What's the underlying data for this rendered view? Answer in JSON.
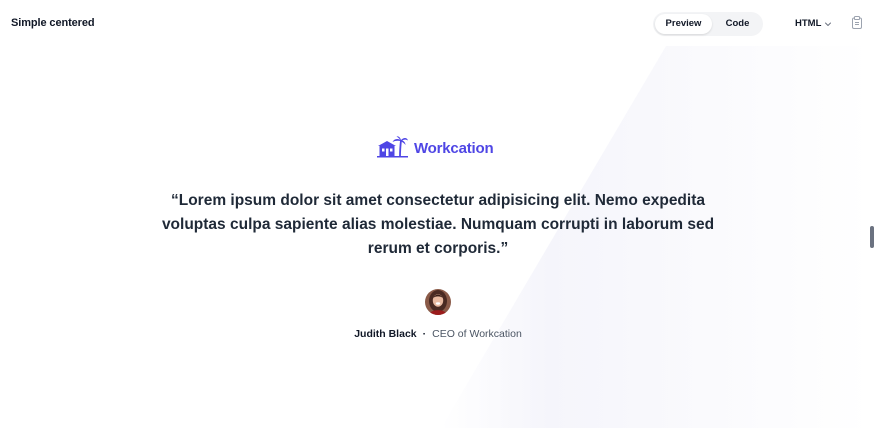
{
  "header": {
    "title": "Simple centered",
    "tabs": [
      {
        "label": "Preview",
        "selected": true
      },
      {
        "label": "Code",
        "selected": false
      }
    ],
    "language": "HTML",
    "language_icon": "chevron-down-icon",
    "copy_icon": "clipboard-icon"
  },
  "preview": {
    "logo_text": "Workcation",
    "logo_icon": "house-palm-icon",
    "quote": "“Lorem ipsum dolor sit amet consectetur adipisicing elit. Nemo expedita voluptas culpa sapiente alias molestiae. Numquam corrupti in laborum sed rerum et corporis.”",
    "author_name": "Judith Black",
    "separator": "·",
    "author_role": "CEO of Workcation",
    "avatar_icon": "avatar-photo"
  },
  "colors": {
    "brand": "#4f46e5",
    "text": "#111827",
    "muted": "#4b5563",
    "segment_bg": "#f3f4f6"
  }
}
